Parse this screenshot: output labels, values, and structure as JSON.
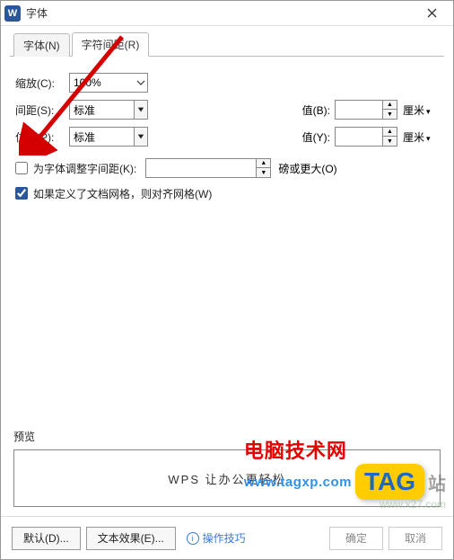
{
  "titlebar": {
    "app_icon_letter": "W",
    "title": "字体"
  },
  "tabs": {
    "font": "字体(N)",
    "spacing": "字符间距(R)"
  },
  "form": {
    "scale_label": "缩放(C):",
    "scale_value": "100%",
    "spacing_label": "间距(S):",
    "spacing_value": "标准",
    "spacing_value_b_label": "值(B):",
    "spacing_value_b": "",
    "spacing_unit_b": "厘米",
    "position_label": "位置(P):",
    "position_value": "标准",
    "position_value_y_label": "值(Y):",
    "position_value_y": "",
    "position_unit_y": "厘米",
    "kerning_label": "为字体调整字间距(K):",
    "kerning_value": "",
    "kerning_after": "磅或更大(O)",
    "snap_label": "如果定义了文档网格，则对齐网格(W)"
  },
  "preview": {
    "label": "预览",
    "text": "WPS 让办公更轻松"
  },
  "footer": {
    "default_btn": "默认(D)...",
    "texteffect_btn": "文本效果(E)...",
    "hint": "操作技巧",
    "ok_btn": "确定",
    "cancel_btn": "取消"
  },
  "watermark": {
    "cn_text": "电脑技术网",
    "url": "www.tagxp.com",
    "tag": "TAG",
    "zhan": "站",
    "url2": "www.x27.com"
  }
}
